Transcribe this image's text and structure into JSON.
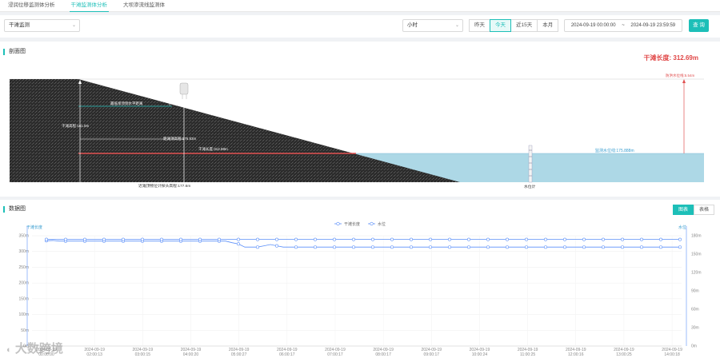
{
  "tabs": [
    {
      "label": "浸润位移监测体分析"
    },
    {
      "label": "干滩监测体分析"
    },
    {
      "label": "大坝渗流线监测体"
    }
  ],
  "toolbar": {
    "monitor_select": "干滩监测",
    "interval_select": "小时",
    "quick_ranges": [
      "昨天",
      "今天",
      "近15天",
      "本月"
    ],
    "active_range": "今天",
    "range_start": "2024-09-19 00:00:00",
    "range_sep": "~",
    "range_end": "2024-09-19 23:59:59",
    "query_label": "查 询"
  },
  "section": {
    "title": "剖面图",
    "dry_beach_length_label": "干滩长度:",
    "dry_beach_length_value": "312.69m",
    "flood_level_label": "防洪水位线:",
    "flood_level_value": "5.54m",
    "water_level_label": "监测水位线:",
    "water_level_value": "175.888m",
    "annotation_top": "最低坝顶到水平距离",
    "height_label": "干滩高程:",
    "height_value": "161.0m",
    "distance_label": "距滩顶高程:",
    "distance_value": "176.83m",
    "length_label": "干滩长度:",
    "length_value": "312.69m",
    "bottom_label": "近滩顶物位计探头高程:",
    "bottom_value": "177.6m",
    "gauge_label": "水位计"
  },
  "data_panel": {
    "title": "数据图",
    "toggle": [
      "图表",
      "表格"
    ],
    "active_toggle": "图表",
    "watermark": "大数跨境"
  },
  "chart_data": {
    "type": "line",
    "left_axis_label": "干滩长度",
    "right_axis_label": "水位",
    "legend": [
      "干滩长度",
      "水位"
    ],
    "left_ticks": [
      "0m",
      "50m",
      "100m",
      "150m",
      "200m",
      "250m",
      "300m",
      "350m"
    ],
    "right_ticks": [
      "0m",
      "30m",
      "60m",
      "90m",
      "120m",
      "150m",
      "180m"
    ],
    "ylim_left": [
      0,
      350
    ],
    "ylim_right": [
      0,
      180
    ],
    "x_labels": [
      [
        "2024-09-19",
        "00:00:00"
      ],
      [
        "2024-09-19",
        "02:00:13"
      ],
      [
        "2024-09-19",
        "03:00:15"
      ],
      [
        "2024-09-19",
        "04:00:20"
      ],
      [
        "2024-09-19",
        "05:00:27"
      ],
      [
        "2024-09-19",
        "06:00:17"
      ],
      [
        "2024-09-19",
        "07:00:17"
      ],
      [
        "2024-09-19",
        "08:00:17"
      ],
      [
        "2024-09-19",
        "09:00:17"
      ],
      [
        "2024-09-19",
        "10:00:24"
      ],
      [
        "2024-09-19",
        "11:00:25"
      ],
      [
        "2024-09-19",
        "12:00:16"
      ],
      [
        "2024-09-19",
        "13:00:25"
      ],
      [
        "2024-09-19",
        "14:00:18"
      ]
    ],
    "series": [
      {
        "name": "干滩长度",
        "axis": "left",
        "color": "#5b8ff9",
        "values": [
          334,
          335,
          333,
          333,
          333,
          333,
          333,
          333,
          333,
          333,
          333,
          333,
          333,
          333,
          333,
          333,
          333,
          333,
          333,
          333,
          333,
          333,
          333,
          333,
          333,
          333,
          333,
          333,
          333,
          328,
          324,
          314,
          314,
          314,
          318,
          322,
          318,
          314,
          314,
          314,
          314,
          314,
          314,
          314,
          314,
          314,
          314,
          314,
          314,
          314,
          314,
          314,
          314,
          314,
          314,
          314,
          314,
          314,
          314,
          314,
          314,
          314,
          314,
          314,
          314,
          314,
          314,
          314,
          314,
          314,
          314,
          314,
          314,
          314,
          314,
          314,
          314,
          314,
          314,
          314,
          314,
          314,
          314,
          314,
          314,
          314,
          314,
          314,
          314,
          314,
          314,
          314,
          314,
          314,
          314,
          314,
          314,
          314,
          314,
          314
        ]
      },
      {
        "name": "水位",
        "axis": "right",
        "color": "#5b8ff9",
        "values": [
          174,
          174,
          174,
          174,
          174,
          174,
          174,
          174,
          174,
          174,
          174,
          174,
          174,
          174,
          174,
          174,
          174,
          174,
          174,
          174,
          174,
          174,
          174,
          174,
          174,
          174,
          174,
          174,
          174,
          174,
          174,
          174,
          174,
          174,
          174,
          174,
          174,
          174,
          174,
          174,
          174,
          174,
          174,
          174,
          174,
          174,
          174,
          174,
          174,
          174,
          174,
          174,
          174,
          174,
          174,
          174,
          174,
          174,
          174,
          174,
          174,
          174,
          174,
          174,
          174,
          174,
          174,
          174,
          174,
          174,
          174,
          174,
          174,
          174,
          174,
          174,
          174,
          174,
          174,
          174,
          174,
          174,
          174,
          174,
          174,
          174,
          174,
          174,
          174,
          174,
          174,
          174,
          174,
          174,
          174,
          174,
          174,
          174,
          174,
          174
        ]
      }
    ],
    "grid": true,
    "legend_position": "top-center"
  },
  "colors": {
    "accent": "#1dbfb8",
    "series": "#5b8ff9",
    "water": "#add8e6",
    "dam": "#2a2a2a",
    "beach_line": "#e05050"
  }
}
